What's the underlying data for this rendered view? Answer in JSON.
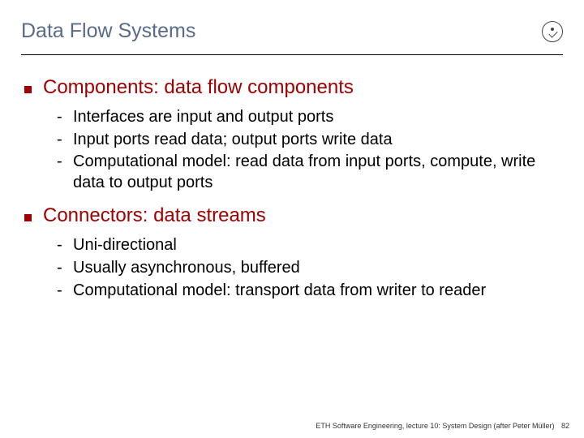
{
  "header": {
    "title": "Data Flow Systems"
  },
  "sections": [
    {
      "title": "Components: data flow components",
      "items": [
        "Interfaces are input and output ports",
        "Input ports read data; output ports write data",
        "Computational model: read data from input ports, compute, write data to output ports"
      ]
    },
    {
      "title": "Connectors: data streams",
      "items": [
        "Uni-directional",
        "Usually asynchronous, buffered",
        "Computational model: transport data from writer to reader"
      ]
    }
  ],
  "footer": {
    "text": "ETH Software Engineering, lecture 10: System Design (after Peter Müller)",
    "page": "82"
  }
}
